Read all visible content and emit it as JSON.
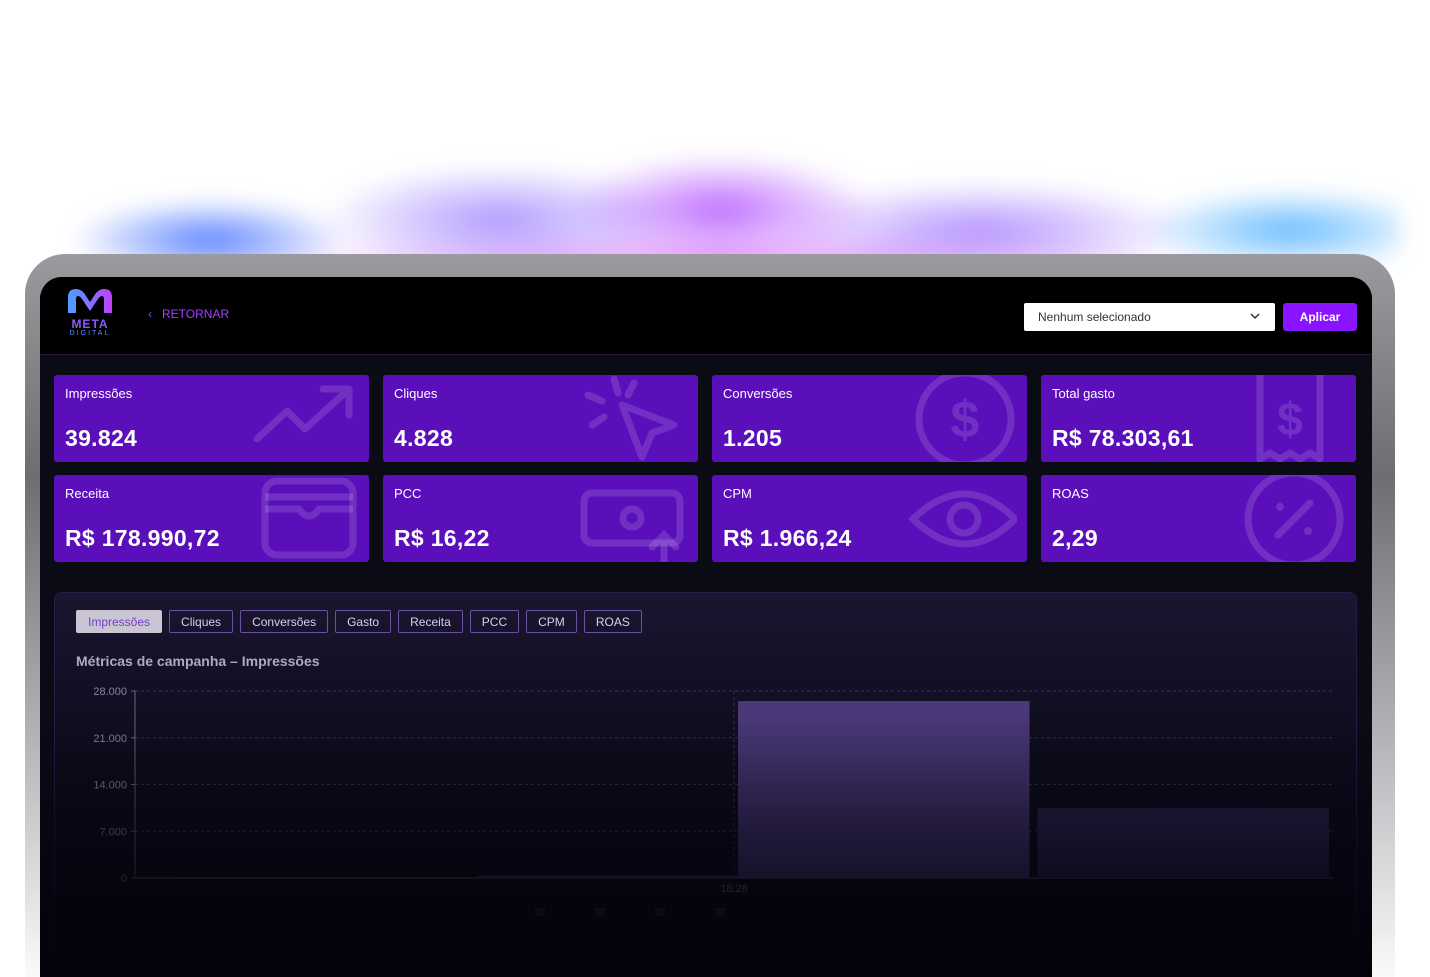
{
  "header": {
    "brand": "META",
    "brand_sub": "DIGITAL",
    "back_label": "RETORNAR",
    "select_value": "Nenhum selecionado",
    "apply_label": "Aplicar"
  },
  "cards": [
    {
      "label": "Impressões",
      "value": "39.824",
      "icon": "trending-up-icon"
    },
    {
      "label": "Cliques",
      "value": "4.828",
      "icon": "cursor-click-icon"
    },
    {
      "label": "Conversões",
      "value": "1.205",
      "icon": "dollar-circle-icon"
    },
    {
      "label": "Total gasto",
      "value": "R$ 78.303,61",
      "icon": "receipt-dollar-icon"
    },
    {
      "label": "Receita",
      "value": "R$ 178.990,72",
      "icon": "wallet-icon"
    },
    {
      "label": "PCC",
      "value": "R$ 16,22",
      "icon": "cash-up-icon"
    },
    {
      "label": "CPM",
      "value": "R$ 1.966,24",
      "icon": "eye-icon"
    },
    {
      "label": "ROAS",
      "value": "2,29",
      "icon": "percent-circle-icon"
    }
  ],
  "tabs": [
    "Impressões",
    "Cliques",
    "Conversões",
    "Gasto",
    "Receita",
    "PCC",
    "CPM",
    "ROAS"
  ],
  "active_tab": 0,
  "panel_title": "Métricas de campanha – Impressões",
  "colors": {
    "card_bg": "#5a0fba",
    "accent": "#8a14ff",
    "bar": "#4a3878"
  },
  "chart_data": {
    "type": "bar",
    "x": [
      "18:28"
    ],
    "series": [
      {
        "values": [
          150
        ]
      },
      {
        "values": [
          350
        ]
      },
      {
        "values": [
          26500
        ]
      },
      {
        "values": [
          10500
        ]
      }
    ],
    "yticks": [
      "28.000",
      "21.000",
      "14.000",
      "7.000",
      "0"
    ],
    "ylim": [
      0,
      28000
    ],
    "grid": true,
    "legend": "bottom"
  }
}
